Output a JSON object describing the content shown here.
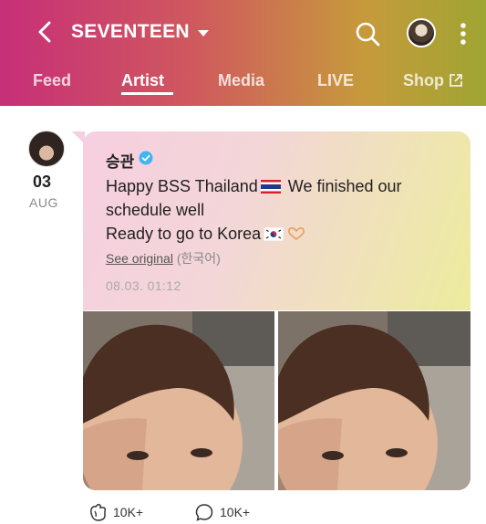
{
  "header": {
    "title": "SEVENTEEN",
    "tabs": [
      {
        "label": "Feed"
      },
      {
        "label": "Artist"
      },
      {
        "label": "Media"
      },
      {
        "label": "LIVE"
      },
      {
        "label": "Shop"
      }
    ],
    "active_tab": "Artist",
    "icons": [
      "back-icon",
      "dropdown-caret-icon",
      "search-icon",
      "profile-avatar",
      "more-vert-icon",
      "external-link-icon"
    ]
  },
  "post": {
    "date_day": "03",
    "date_month": "AUG",
    "author": "승관",
    "verified": true,
    "line1": "Happy BSS Thailand",
    "line1_tail": "We finished our schedule well",
    "line2": "Ready to go to Korea",
    "see_original": "See original",
    "lang": "(한국어)",
    "timestamp": "08.03. 01:12",
    "emoji": [
      "thailand-flag",
      "korea-flag",
      "heart-hands"
    ],
    "photos": 2
  },
  "actions": {
    "cheer_count": "10K+",
    "comment_count": "10K+"
  },
  "colors": {
    "header_start": "#c72f78",
    "header_end": "#9fa533",
    "bubble_start": "#f6cfe0",
    "bubble_end": "#ecec9d",
    "verified": "#3fb6f0"
  }
}
